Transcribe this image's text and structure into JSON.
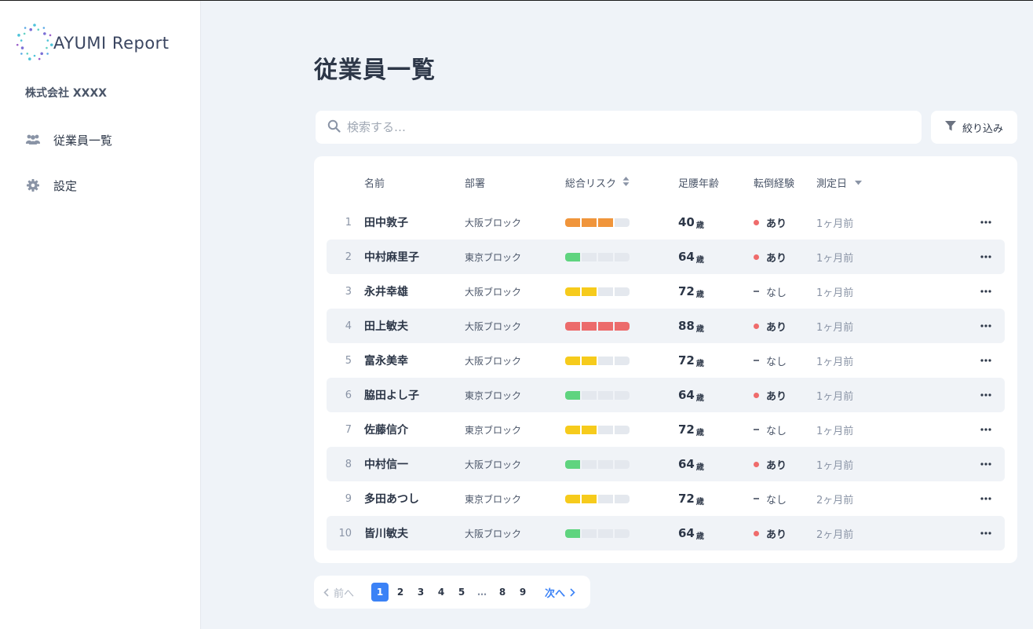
{
  "brand": {
    "name": "AYUMI Report"
  },
  "sidebar": {
    "company": "株式会社 XXXX",
    "items": [
      {
        "label": "従業員一覧",
        "icon": "users-icon"
      },
      {
        "label": "設定",
        "icon": "gear-icon"
      }
    ]
  },
  "main": {
    "title": "従業員一覧",
    "search": {
      "placeholder": "検索する…",
      "value": ""
    },
    "filter": {
      "label": "絞り込み"
    }
  },
  "table": {
    "columns": {
      "name": "名前",
      "dept": "部署",
      "risk": "総合リスク",
      "age": "足腰年齢",
      "fall": "転倒経験",
      "date": "測定日"
    },
    "age_unit": "歳",
    "fall_labels": {
      "yes": "あり",
      "no": "なし"
    },
    "risk_colors": {
      "1": "#5fd47f",
      "2": "#f6cb1c",
      "3": "#f0953b",
      "4": "#ec6b6b",
      "empty": "#e4e8ee"
    },
    "rows": [
      {
        "no": "1",
        "name": "田中敦子",
        "dept": "大阪ブロック",
        "risk": 3,
        "age": "40",
        "fall": "yes",
        "date": "1ヶ月前"
      },
      {
        "no": "2",
        "name": "中村麻里子",
        "dept": "東京ブロック",
        "risk": 1,
        "age": "64",
        "fall": "yes",
        "date": "1ヶ月前"
      },
      {
        "no": "3",
        "name": "永井幸雄",
        "dept": "大阪ブロック",
        "risk": 2,
        "age": "72",
        "fall": "no",
        "date": "1ヶ月前"
      },
      {
        "no": "4",
        "name": "田上敏夫",
        "dept": "大阪ブロック",
        "risk": 4,
        "age": "88",
        "fall": "yes",
        "date": "1ヶ月前"
      },
      {
        "no": "5",
        "name": "富永美幸",
        "dept": "大阪ブロック",
        "risk": 2,
        "age": "72",
        "fall": "no",
        "date": "1ヶ月前"
      },
      {
        "no": "6",
        "name": "脇田よし子",
        "dept": "東京ブロック",
        "risk": 1,
        "age": "64",
        "fall": "yes",
        "date": "1ヶ月前"
      },
      {
        "no": "7",
        "name": "佐藤信介",
        "dept": "東京ブロック",
        "risk": 2,
        "age": "72",
        "fall": "no",
        "date": "1ヶ月前"
      },
      {
        "no": "8",
        "name": "中村信一",
        "dept": "大阪ブロック",
        "risk": 1,
        "age": "64",
        "fall": "yes",
        "date": "1ヶ月前"
      },
      {
        "no": "9",
        "name": "多田あつし",
        "dept": "東京ブロック",
        "risk": 2,
        "age": "72",
        "fall": "no",
        "date": "2ヶ月前"
      },
      {
        "no": "10",
        "name": "皆川敏夫",
        "dept": "大阪ブロック",
        "risk": 1,
        "age": "64",
        "fall": "yes",
        "date": "2ヶ月前"
      }
    ]
  },
  "pagination": {
    "prev": "前へ",
    "next": "次へ",
    "pages": [
      "1",
      "2",
      "3",
      "4",
      "5",
      "…",
      "8",
      "9"
    ],
    "current": "1"
  }
}
